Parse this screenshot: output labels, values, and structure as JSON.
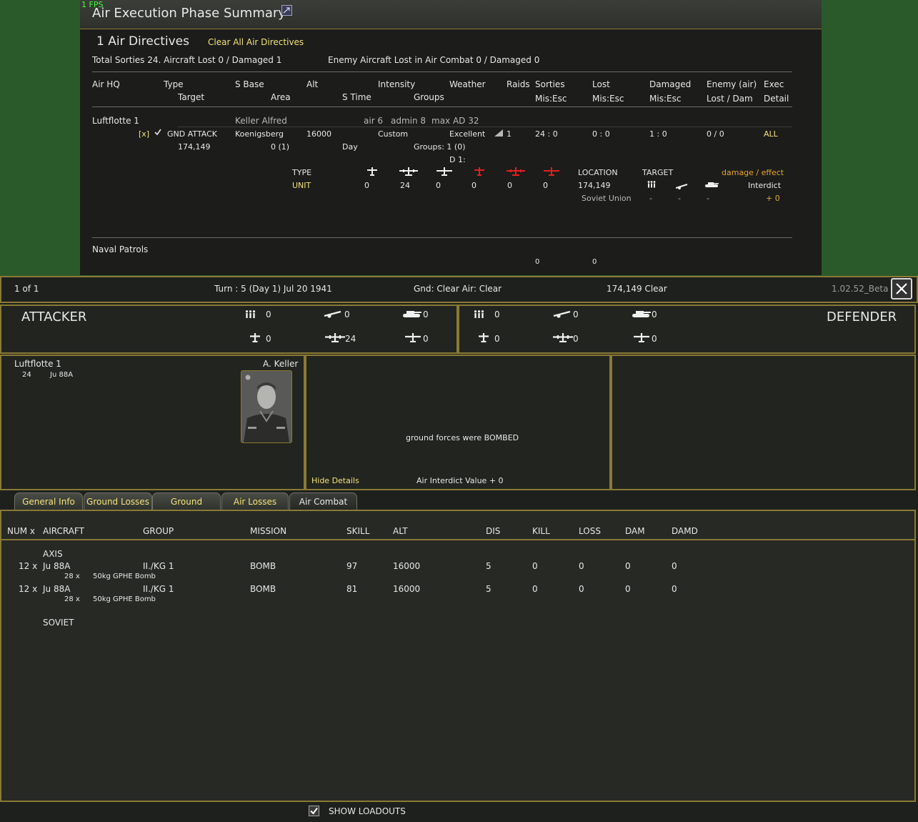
{
  "fps": "1 FPS",
  "summary": {
    "title": "Air Execution Phase Summary",
    "directives_title": "1 Air Directives",
    "clear_all": "Clear All Air Directives",
    "totals": "Total Sorties 24. Aircraft Lost 0 / Damaged 1",
    "enemy_totals": "Enemy Aircraft Lost in Air Combat 0 / Damaged 0",
    "headers_row1": [
      "Air HQ",
      "Type",
      "S Base",
      "Alt",
      "Intensity",
      "Weather",
      "Raids",
      "Sorties",
      "Lost",
      "Damaged",
      "Enemy (air)",
      "Exec"
    ],
    "headers_row2": [
      "Target",
      "Area",
      "S Time",
      "Groups",
      "Mis:Esc",
      "Mis:Esc",
      "Mis:Esc",
      "Lost / Dam",
      "Detail"
    ],
    "hq": {
      "name": "Luftflotte 1",
      "commander": "Keller Alfred",
      "air": "air 6",
      "admin": "admin 8",
      "max_ad": "max AD 32"
    },
    "directive": {
      "flag": "[x]",
      "type": "GND ATTACK",
      "base": "Koenigsberg",
      "alt": "16000",
      "intensity": "Custom",
      "weather": "Excellent",
      "raids": "1",
      "sorties": "24 : 0",
      "lost": "0 : 0",
      "damaged": "1 : 0",
      "enemy": "0 / 0",
      "exec": "ALL",
      "target": "174,149",
      "area": "0 (1)",
      "stime": "Day",
      "groups": "Groups: 1   (0)",
      "day": "D 1:"
    },
    "detail": {
      "type_label": "TYPE",
      "unit_label": "UNIT",
      "unit_values": [
        "0",
        "24",
        "0",
        "0",
        "0",
        "0"
      ],
      "location_label": "LOCATION",
      "location": "174,149",
      "country": "Soviet Union",
      "target_label": "TARGET",
      "target_values": [
        "-",
        "-",
        "-"
      ],
      "damage_label": "damage / effect",
      "damage_type": "Interdict",
      "damage_value": "+ 0"
    },
    "naval": "Naval Patrols",
    "naval_values": [
      "0",
      "0"
    ]
  },
  "status": {
    "page": "1 of 1",
    "turn": "Turn : 5 (Day 1)   Jul 20 1941",
    "conditions": "Gnd: Clear   Air: Clear",
    "location": "174,149    Clear",
    "version": "1.02.52_Beta"
  },
  "attacker": {
    "label": "ATTACKER",
    "men": "0",
    "guns": "0",
    "afv": "0",
    "fighters": "0",
    "bombers": "24",
    "recon": "0"
  },
  "defender": {
    "label": "DEFENDER",
    "men": "0",
    "guns": "0",
    "afv": "0",
    "fighters": "0",
    "bombers": "0",
    "recon": "0"
  },
  "unit": {
    "name": "Luftflotte 1",
    "count": "24",
    "aircraft": "Ju 88A",
    "leader": "A. Keller"
  },
  "result": {
    "message": "ground forces were BOMBED",
    "hide": "Hide Details",
    "interdict": "Air Interdict Value  + 0"
  },
  "tabs": [
    "General Info",
    "Ground Losses",
    "Ground Combat",
    "Air Losses",
    "Air Combat"
  ],
  "table": {
    "headers": [
      "NUM x",
      "AIRCRAFT",
      "GROUP",
      "MISSION",
      "SKILL",
      "ALT",
      "DIS",
      "KILL",
      "LOSS",
      "DAM",
      "DAMD"
    ],
    "axis_label": "AXIS",
    "soviet_label": "SOVIET",
    "rows": [
      {
        "num": "12 x",
        "aircraft": "Ju 88A",
        "group": "II./KG 1",
        "mission": "BOMB",
        "skill": "97",
        "alt": "16000",
        "dis": "5",
        "kill": "0",
        "loss": "0",
        "dam": "0",
        "damd": "0",
        "load_num": "28 x",
        "load": "50kg GPHE Bomb"
      },
      {
        "num": "12 x",
        "aircraft": "Ju 88A",
        "group": "II./KG 1",
        "mission": "BOMB",
        "skill": "81",
        "alt": "16000",
        "dis": "5",
        "kill": "0",
        "loss": "0",
        "dam": "0",
        "damd": "0",
        "load_num": "28 x",
        "load": "50kg GPHE Bomb"
      }
    ]
  },
  "show_loadouts": "SHOW LOADOUTS",
  "colors": {
    "accent": "#f2e27a",
    "orange": "#e8a52a",
    "frame": "#8a7a35",
    "enemy": "#e02020"
  }
}
